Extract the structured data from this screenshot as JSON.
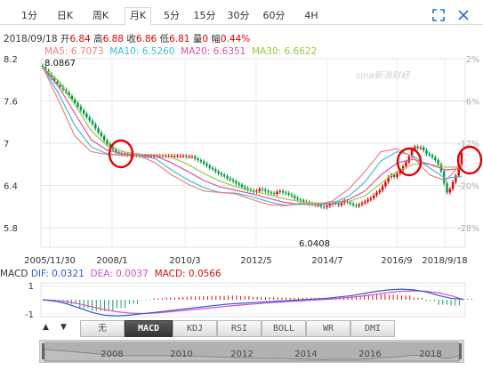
{
  "tabs": [
    {
      "label": "1分",
      "active": false
    },
    {
      "label": "日K",
      "active": false
    },
    {
      "label": "周K",
      "active": false
    },
    {
      "label": "月K",
      "active": true
    },
    {
      "label": "5分",
      "active": false
    },
    {
      "label": "15分",
      "active": false
    },
    {
      "label": "30分",
      "active": false
    },
    {
      "label": "60分",
      "active": false
    },
    {
      "label": "4H",
      "active": false
    }
  ],
  "toolbar": {
    "fullscreen_icon": "expand-icon",
    "close_icon": "close-icon"
  },
  "quote": {
    "date": "2018/09/18",
    "open_label": "开",
    "open": "6.84",
    "high_label": "高",
    "high": "6.88",
    "close_label": "收",
    "close": "6.86",
    "low_label": "低",
    "low": "6.81",
    "volume_label": "量",
    "volume": "0",
    "change_label": "幅",
    "change": "0.44%"
  },
  "ma": {
    "ma5": "MA5: 6.7073",
    "ma10": "MA10: 6.5260",
    "ma20": "MA20: 6.6351",
    "ma30": "MA30: 6.6622",
    "colors": {
      "ma5": "#f08080",
      "ma10": "#3cbcd8",
      "ma20": "#e44fa8",
      "ma30": "#9cc645"
    }
  },
  "watermark": "sina新浪财经",
  "chart_data": {
    "type": "candlestick",
    "period": "monthly",
    "y_ticks": [
      "8.2",
      "7.6",
      "7",
      "6.4",
      "5.8"
    ],
    "pct_ticks": [
      "2%",
      "-6%",
      "-12%",
      "-20%",
      "-28%"
    ],
    "x_ticks": [
      "2005/11/30",
      "2008/1",
      "2010/3",
      "2012/5",
      "2014/7",
      "2016/9",
      "2018/9/18"
    ],
    "ylim": [
      5.8,
      8.2
    ],
    "annotations": {
      "max": "8.0867",
      "min": "6.0408"
    },
    "up_color": "#e00000",
    "down_color": "#009a44",
    "close_series": [
      8.08,
      8.03,
      7.98,
      7.93,
      7.88,
      7.84,
      7.8,
      7.76,
      7.72,
      7.67,
      7.62,
      7.57,
      7.52,
      7.47,
      7.42,
      7.37,
      7.32,
      7.27,
      7.21,
      7.15,
      7.1,
      7.04,
      6.99,
      6.95,
      6.91,
      6.87,
      6.85,
      6.84,
      6.84,
      6.83,
      6.83,
      6.83,
      6.83,
      6.82,
      6.82,
      6.82,
      6.82,
      6.82,
      6.82,
      6.82,
      6.82,
      6.82,
      6.82,
      6.82,
      6.82,
      6.82,
      6.82,
      6.82,
      6.82,
      6.81,
      6.81,
      6.81,
      6.78,
      6.76,
      6.74,
      6.71,
      6.68,
      6.65,
      6.63,
      6.6,
      6.57,
      6.55,
      6.53,
      6.5,
      6.48,
      6.46,
      6.43,
      6.41,
      6.38,
      6.36,
      6.34,
      6.33,
      6.31,
      6.32,
      6.35,
      6.34,
      6.32,
      6.3,
      6.29,
      6.28,
      6.31,
      6.32,
      6.3,
      6.29,
      6.27,
      6.25,
      6.22,
      6.2,
      6.19,
      6.17,
      6.16,
      6.14,
      6.13,
      6.12,
      6.12,
      6.1,
      6.09,
      6.11,
      6.13,
      6.15,
      6.14,
      6.12,
      6.15,
      6.18,
      6.16,
      6.14,
      6.12,
      6.11,
      6.13,
      6.15,
      6.17,
      6.2,
      6.22,
      6.26,
      6.3,
      6.33,
      6.39,
      6.45,
      6.52,
      6.55,
      6.52,
      6.57,
      6.62,
      6.67,
      6.73,
      6.81,
      6.91,
      6.95,
      6.93,
      6.94,
      6.9,
      6.85,
      6.83,
      6.8,
      6.76,
      6.7,
      6.6,
      6.43,
      6.3,
      6.35,
      6.45,
      6.54,
      6.7,
      6.86
    ],
    "ma_series": {
      "ma5": [
        8.08,
        7.6,
        7.1,
        6.88,
        6.84,
        6.83,
        6.82,
        6.72,
        6.55,
        6.42,
        6.32,
        6.3,
        6.28,
        6.2,
        6.13,
        6.11,
        6.15,
        6.13,
        6.18,
        6.35,
        6.6,
        6.88,
        6.92,
        6.8,
        6.55,
        6.47,
        6.71
      ],
      "ma10": [
        8.08,
        7.7,
        7.25,
        6.95,
        6.85,
        6.83,
        6.82,
        6.78,
        6.62,
        6.48,
        6.37,
        6.3,
        6.29,
        6.24,
        6.17,
        6.12,
        6.13,
        6.14,
        6.15,
        6.25,
        6.45,
        6.75,
        6.88,
        6.82,
        6.65,
        6.5,
        6.53
      ],
      "ma20": [
        8.08,
        7.8,
        7.42,
        7.05,
        6.9,
        6.85,
        6.83,
        6.82,
        6.72,
        6.6,
        6.47,
        6.38,
        6.33,
        6.28,
        6.22,
        6.16,
        6.13,
        6.13,
        6.14,
        6.2,
        6.32,
        6.55,
        6.72,
        6.77,
        6.7,
        6.62,
        6.64
      ],
      "ma30": [
        8.08,
        7.88,
        7.55,
        7.18,
        6.96,
        6.88,
        6.84,
        6.83,
        6.8,
        6.7,
        6.57,
        6.46,
        6.38,
        6.32,
        6.27,
        6.21,
        6.17,
        6.15,
        6.15,
        6.17,
        6.25,
        6.43,
        6.6,
        6.7,
        6.7,
        6.66,
        6.66
      ]
    },
    "highlight_circles": [
      "2008/1",
      "2016/9",
      "2018/9/18"
    ]
  },
  "macd": {
    "label": "MACD",
    "dif": "DIF: 0.0321",
    "dea": "DEA: 0.0037",
    "macd": "MACD: 0.0566",
    "y_ticks": [
      "1",
      "-1"
    ],
    "colors": {
      "dif": "#2b5bd7",
      "dea": "#d84fc6",
      "macd": "#d01010"
    },
    "dif_series": [
      0,
      -0.1,
      -0.3,
      -0.6,
      -0.9,
      -1.1,
      -1.15,
      -1.1,
      -1.0,
      -0.9,
      -0.8,
      -0.7,
      -0.6,
      -0.5,
      -0.4,
      -0.3,
      -0.25,
      -0.2,
      -0.15,
      -0.1,
      -0.05,
      0.0,
      0.05,
      0.1,
      0.2,
      0.3,
      0.45,
      0.6,
      0.7,
      0.75,
      0.7,
      0.55,
      0.3,
      0.1,
      0.03
    ],
    "dea_series": [
      0,
      -0.05,
      -0.15,
      -0.3,
      -0.5,
      -0.7,
      -0.85,
      -0.95,
      -0.98,
      -0.95,
      -0.88,
      -0.8,
      -0.72,
      -0.63,
      -0.54,
      -0.45,
      -0.38,
      -0.3,
      -0.24,
      -0.18,
      -0.12,
      -0.07,
      -0.02,
      0.03,
      0.1,
      0.18,
      0.28,
      0.4,
      0.52,
      0.6,
      0.63,
      0.6,
      0.48,
      0.3,
      0.0
    ]
  },
  "indicators": {
    "prev_arrow": "▲",
    "next_arrow": "▼",
    "buttons": [
      {
        "label": "无",
        "active": false
      },
      {
        "label": "MACD",
        "active": true
      },
      {
        "label": "KDJ",
        "active": false
      },
      {
        "label": "RSI",
        "active": false
      },
      {
        "label": "BOLL",
        "active": false
      },
      {
        "label": "WR",
        "active": false
      },
      {
        "label": "DMI",
        "active": false
      }
    ]
  },
  "scrollbar": {
    "years": [
      "2008",
      "2010",
      "2012",
      "2014",
      "2016",
      "2018"
    ]
  }
}
